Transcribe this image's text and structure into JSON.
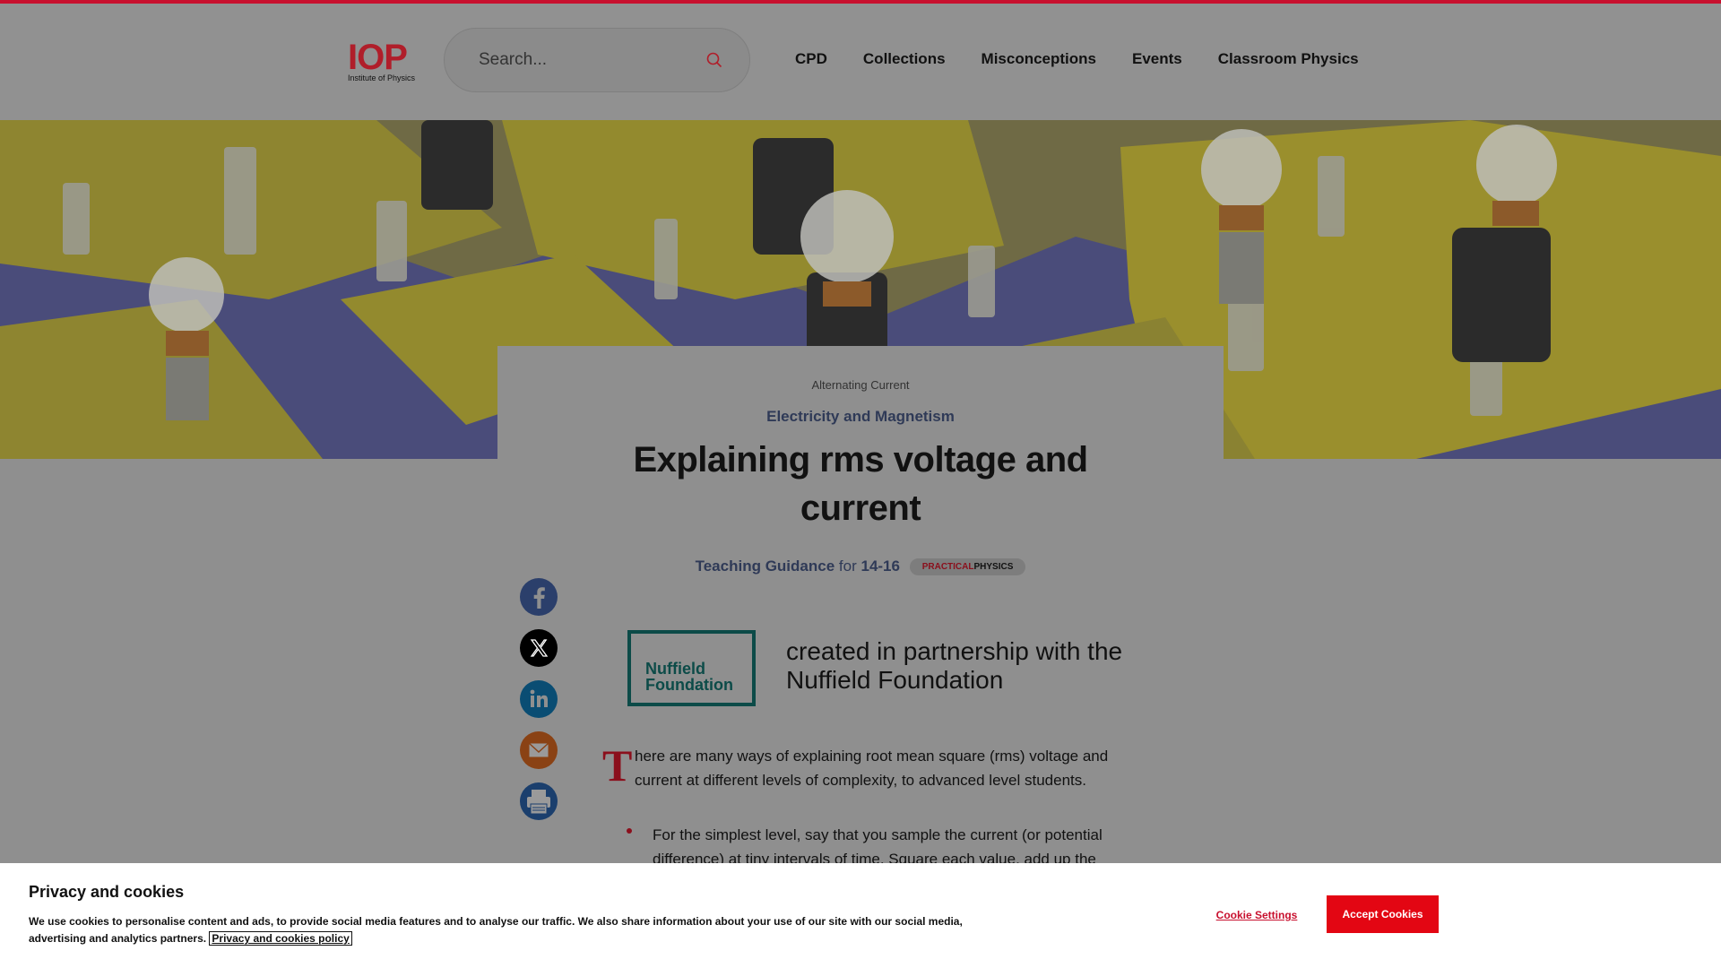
{
  "colors": {
    "brand_red": "#c8102e",
    "dark_red": "#8b0f1c",
    "navy": "#2f3a57",
    "teal": "#0c4b48",
    "overlay_gray": "#8f8f8f"
  },
  "header": {
    "logo_mark": "IOP",
    "logo_subtitle": "Institute of Physics",
    "search_placeholder": "Search...",
    "search_icon": "search-icon",
    "nav": [
      {
        "label": "CPD"
      },
      {
        "label": "Collections"
      },
      {
        "label": "Misconceptions"
      },
      {
        "label": "Events"
      },
      {
        "label": "Classroom Physics"
      }
    ]
  },
  "article": {
    "breadcrumb": "Alternating Current",
    "topic": "Electricity and Magnetism",
    "title": "Explaining rms voltage and current",
    "meta_type": "Teaching Guidance",
    "meta_for": "for",
    "meta_age": "14-16",
    "badge_part1": "PRACTICAL",
    "badge_part2": "PHYSICS",
    "partner_logo_line1": "Nuffield",
    "partner_logo_line2": "Foundation",
    "partner_text": "created in partnership with the Nuffield Foundation",
    "dropcap": "T",
    "intro": "here are many ways of explaining root mean square (rms) voltage and current at different levels of complexity, to advanced level students.",
    "bullet_1": "For the simplest level, say that you sample the current (or potential difference) at tiny intervals of time. Square each value, add up the"
  },
  "share": [
    {
      "icon": "facebook-icon",
      "color": "#3b5998"
    },
    {
      "icon": "x-icon",
      "color": "#000000"
    },
    {
      "icon": "linkedin-icon",
      "color": "#0e76a8"
    },
    {
      "icon": "email-icon",
      "color": "#e36b1a"
    },
    {
      "icon": "print-icon",
      "color": "#1f5fa8"
    }
  ],
  "cookie_banner": {
    "title": "Privacy and cookies",
    "text": "We use cookies to personalise content and ads, to provide social media features and to analyse our traffic. We also share information about your use of our site with our social media, advertising and analytics partners.",
    "policy_link": "Privacy and cookies policy",
    "settings_label": "Cookie Settings",
    "accept_label": "Accept Cookies"
  }
}
